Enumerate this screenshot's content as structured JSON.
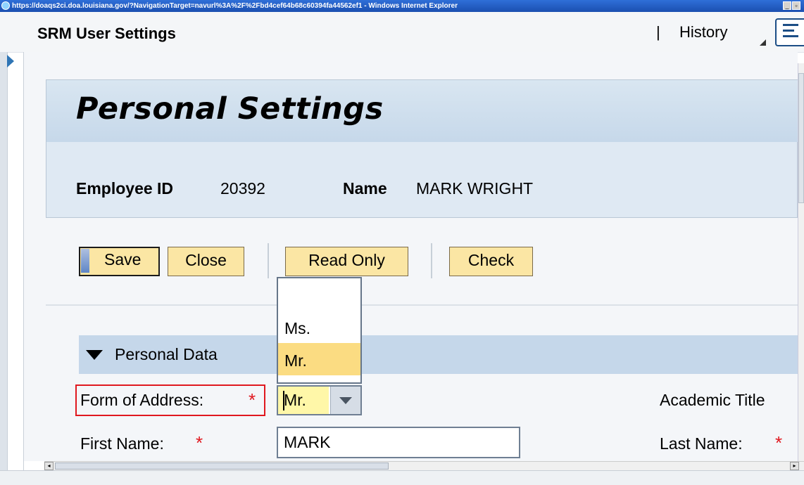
{
  "browser": {
    "title": "https://doaqs2ci.doa.louisiana.gov/?NavigationTarget=navurl%3A%2F%2Fbd4cef64b68c60394fa44562ef1 - Windows Internet Explorer",
    "min_glyph": "_",
    "max_glyph": "▫"
  },
  "header": {
    "app_title": "SRM User Settings",
    "separator": "|",
    "history_label": "History",
    "menu_icon": "menu-icon"
  },
  "page": {
    "title": "Personal Settings",
    "employee_id_label": "Employee ID",
    "employee_id_value": "20392",
    "name_label": "Name",
    "name_value": "MARK WRIGHT"
  },
  "toolbar": {
    "save_label": "Save",
    "close_label": "Close",
    "read_only_label": "Read Only",
    "check_label": "Check"
  },
  "section": {
    "title": "Personal Data",
    "icon": "triangle-down-icon"
  },
  "form": {
    "form_of_address_label": "Form of Address:",
    "form_of_address_value": "Mr.",
    "required_marker": "*",
    "first_name_label": "First Name:",
    "first_name_value": "MARK",
    "academic_title_label": "Academic Title",
    "last_name_label": "Last Name:"
  },
  "dropdown": {
    "options": [
      "",
      "Ms.",
      "Mr."
    ],
    "selected": "Mr."
  },
  "colors": {
    "button_fill": "#fbe6a4",
    "selected_option": "#fbdc82",
    "required": "#e0181f",
    "section_bar": "#c5d7ea",
    "panel": "#dfe9f3"
  }
}
